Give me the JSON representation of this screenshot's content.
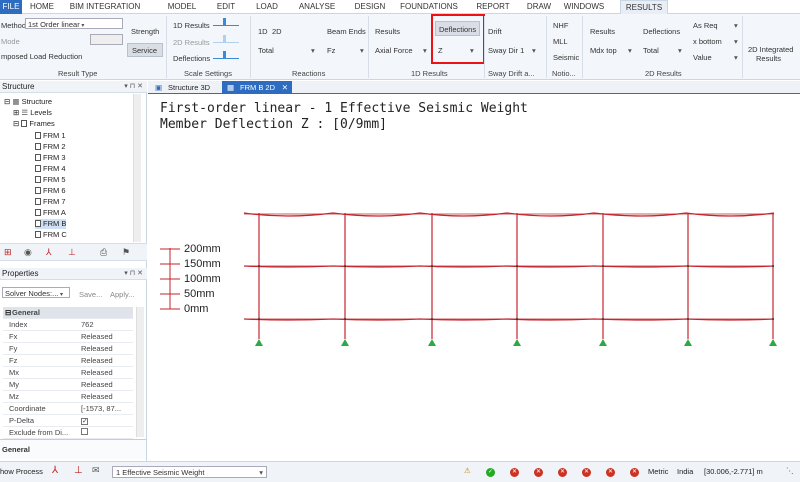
{
  "menu": {
    "tabs": [
      "FILE",
      "HOME",
      "BIM INTEGRATION",
      "MODEL",
      "EDIT",
      "LOAD",
      "ANALYSE",
      "DESIGN",
      "FOUNDATIONS",
      "REPORT",
      "DRAW",
      "WINDOWS",
      "RESULTS"
    ],
    "active": "RESULTS"
  },
  "ribbon": {
    "method_label": "Method",
    "method_value": "1st Order linear",
    "mode_label": "Mode",
    "imposed_label": "mposed Load Reduction",
    "strength": "Strength",
    "service": "Service",
    "results_1d": "1D Results",
    "results_2d": "2D Results",
    "deflections": "Deflections",
    "d1": "1D",
    "d2": "2D",
    "total": "Total",
    "beam_ends": "Beam Ends",
    "fz": "Fz",
    "results": "Results",
    "axial_force": "Axial Force",
    "defl_btn": "Deflections",
    "z": "Z",
    "drift": "Drift",
    "sway_dir": "Sway Dir 1",
    "nhf": "NHF",
    "mll": "MLL",
    "seismic": "Seismic",
    "results2": "Results",
    "mdx_top": "Mdx top",
    "deflections2": "Deflections",
    "total2": "Total",
    "as_req": "As Req",
    "x_bottom": "x bottom",
    "value": "Value",
    "integrated": "2D Integrated",
    "integrated2": "Results",
    "groups": {
      "result_type": "Result Type",
      "scale_settings": "Scale Settings",
      "reactions": "Reactions",
      "results_1d": "1D Results",
      "sway_drift": "Sway Drift a...",
      "notio": "Notio...",
      "results_2d": "2D Results"
    }
  },
  "structure_panel": {
    "title": "Structure",
    "root": "Structure",
    "levels": "Levels",
    "frames": "Frames",
    "items": [
      "FRM 1",
      "FRM 2",
      "FRM 3",
      "FRM 4",
      "FRM 5",
      "FRM 6",
      "FRM 7",
      "FRM A",
      "FRM B",
      "FRM C"
    ],
    "selected": "FRM B"
  },
  "properties_panel": {
    "title": "Properties",
    "selector": "Solver Nodes:...",
    "save": "Save...",
    "apply": "Apply...",
    "category": "General",
    "rows": [
      {
        "k": "Index",
        "v": "762"
      },
      {
        "k": "Fx",
        "v": "Released"
      },
      {
        "k": "Fy",
        "v": "Released"
      },
      {
        "k": "Fz",
        "v": "Released"
      },
      {
        "k": "Mx",
        "v": "Released"
      },
      {
        "k": "My",
        "v": "Released"
      },
      {
        "k": "Mz",
        "v": "Released"
      },
      {
        "k": "Coordinate",
        "v": "[-1573, 87..."
      },
      {
        "k": "P-Delta",
        "v": ""
      },
      {
        "k": "Exclude from Di...",
        "v": ""
      }
    ],
    "footer": "General"
  },
  "doc_tabs": [
    "Structure 3D",
    "FRM B 2D"
  ],
  "canvas": {
    "title_line1": "First-order linear - 1 Effective Seismic Weight",
    "title_line2": "Member Deflection Z : [0/9mm]",
    "scale_labels": [
      "200mm",
      "150mm",
      "100mm",
      "50mm",
      "0mm"
    ],
    "colors": {
      "frame": "#c4262e",
      "support": "#2ea84a"
    }
  },
  "status": {
    "show_process": "how Process",
    "load_case": "1 Effective Seismic Weight",
    "units": "Metric",
    "region": "India",
    "coords": "[30.006,-2.771] m"
  }
}
